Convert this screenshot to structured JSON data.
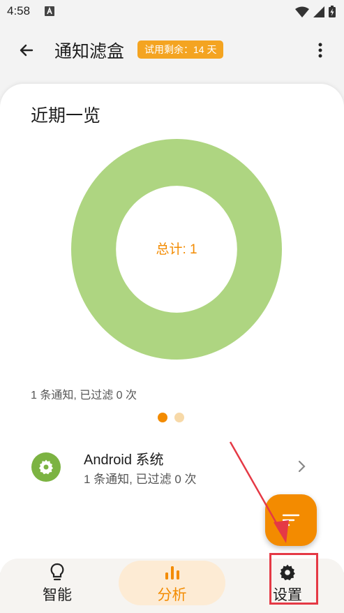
{
  "status_bar": {
    "time": "4:58"
  },
  "app_bar": {
    "title": "通知滤盒",
    "trial_badge": "试用剩余：14 天"
  },
  "overview": {
    "title": "近期一览",
    "donut_center_label": "总计: 1",
    "summary": "1 条通知, 已过滤 0 次",
    "page_count": 2,
    "active_page": 0
  },
  "chart_data": {
    "type": "pie",
    "values": [
      1
    ],
    "center_label": "总计: 1",
    "colors": [
      "#aed581"
    ]
  },
  "app_list": [
    {
      "name": "Android 系统",
      "detail": "1 条通知, 已过滤 0 次",
      "icon": "gear-icon"
    }
  ],
  "bottom_nav": {
    "items": [
      {
        "label": "智能",
        "icon": "lightbulb-icon"
      },
      {
        "label": "分析",
        "icon": "bar-chart-icon",
        "selected": true
      },
      {
        "label": "设置",
        "icon": "gear-icon"
      }
    ]
  },
  "colors": {
    "accent": "#f38b00",
    "badge": "#f4a421",
    "donut": "#aed581",
    "app_icon": "#7cb342",
    "annotation": "#e53945"
  }
}
